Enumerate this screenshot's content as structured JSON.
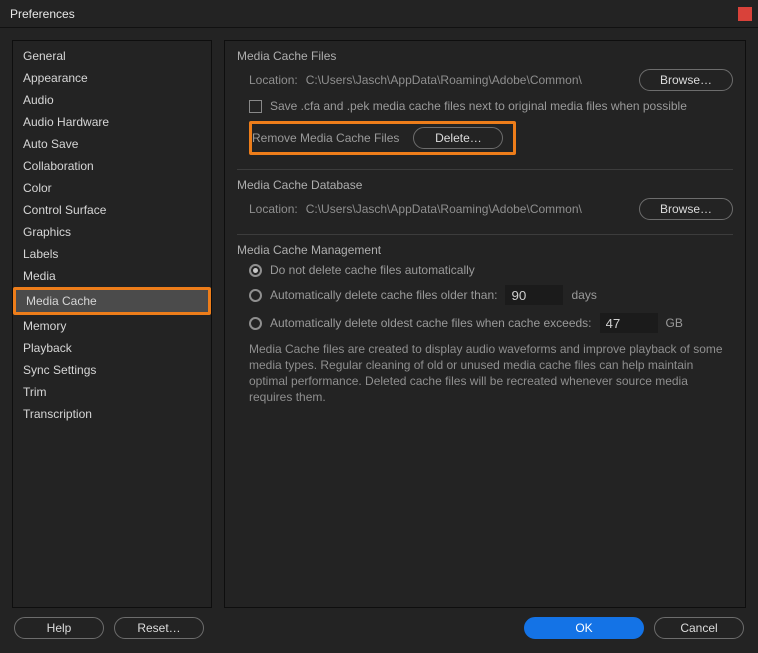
{
  "window": {
    "title": "Preferences"
  },
  "sidebar": {
    "items": [
      "General",
      "Appearance",
      "Audio",
      "Audio Hardware",
      "Auto Save",
      "Collaboration",
      "Color",
      "Control Surface",
      "Graphics",
      "Labels",
      "Media",
      "Media Cache",
      "Memory",
      "Playback",
      "Sync Settings",
      "Trim",
      "Transcription"
    ],
    "selected": "Media Cache"
  },
  "cacheFiles": {
    "title": "Media Cache Files",
    "locationLabel": "Location:",
    "locationPath": "C:\\Users\\Jasch\\AppData\\Roaming\\Adobe\\Common\\",
    "browse": "Browse…",
    "saveNextTo": "Save .cfa and .pek media cache files next to original media files when possible",
    "removeLabel": "Remove Media Cache Files",
    "delete": "Delete…"
  },
  "cacheDb": {
    "title": "Media Cache Database",
    "locationLabel": "Location:",
    "locationPath": "C:\\Users\\Jasch\\AppData\\Roaming\\Adobe\\Common\\",
    "browse": "Browse…"
  },
  "management": {
    "title": "Media Cache Management",
    "optA": "Do not delete cache files automatically",
    "optB_pre": "Automatically delete cache files older than:",
    "optB_value": "90",
    "optB_suffix": "days",
    "optC_pre": "Automatically delete oldest cache files when cache exceeds:",
    "optC_value": "47",
    "optC_suffix": "GB",
    "info": "Media Cache files are created to display audio waveforms and improve playback of some media types.  Regular cleaning of old or unused media cache files can help maintain optimal performance. Deleted cache files will be recreated whenever source media requires them."
  },
  "footer": {
    "help": "Help",
    "reset": "Reset…",
    "ok": "OK",
    "cancel": "Cancel"
  }
}
